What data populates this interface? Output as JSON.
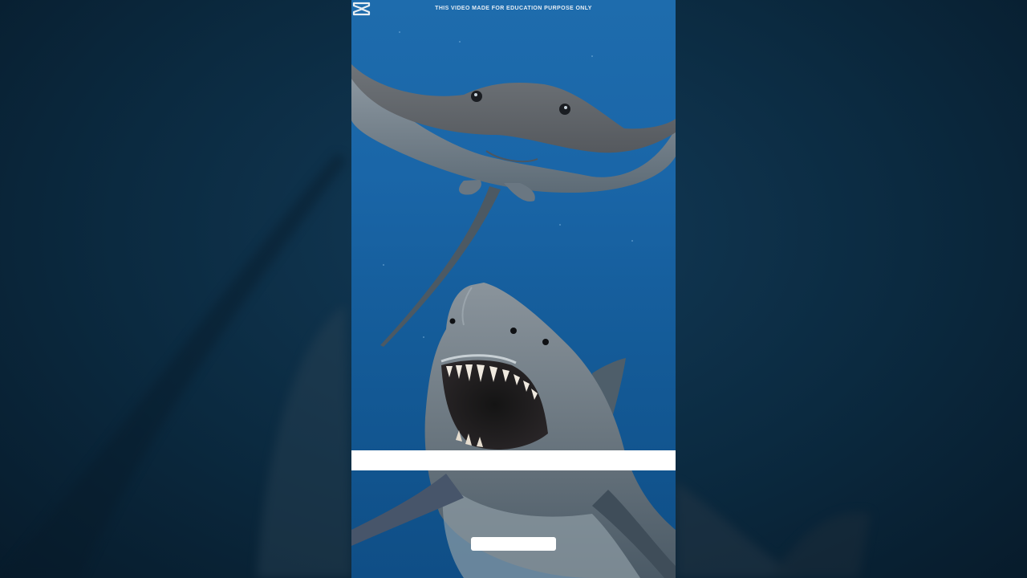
{
  "video": {
    "caption": "THIS VIDEO MADE FOR EDUCATION PURPOSE ONLY"
  },
  "scene": {
    "subjects": [
      "stingray",
      "great-white-shark"
    ],
    "water_color": "#1a66a8",
    "background_color": "#0b2a40",
    "overlay_color": "#ffffff"
  },
  "icons": {
    "watermark": "capcut-logo-icon"
  }
}
